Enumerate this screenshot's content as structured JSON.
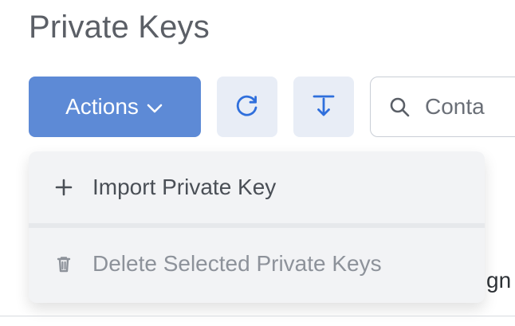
{
  "page": {
    "title": "Private Keys"
  },
  "toolbar": {
    "actions_label": "Actions",
    "refresh_icon": "refresh-icon",
    "export_icon": "download-icon",
    "search_placeholder_visible": "Conta",
    "colors": {
      "primary": "#5d8ad6",
      "icon_button_bg": "#e8edf6",
      "icon_color": "#2f6fdc"
    }
  },
  "actions_menu": {
    "items": [
      {
        "label": "Import Private Key",
        "icon": "plus-icon",
        "enabled": true
      },
      {
        "label": "Delete Selected Private Keys",
        "icon": "trash-icon",
        "enabled": false
      }
    ]
  },
  "background": {
    "partial_text": "gn"
  }
}
